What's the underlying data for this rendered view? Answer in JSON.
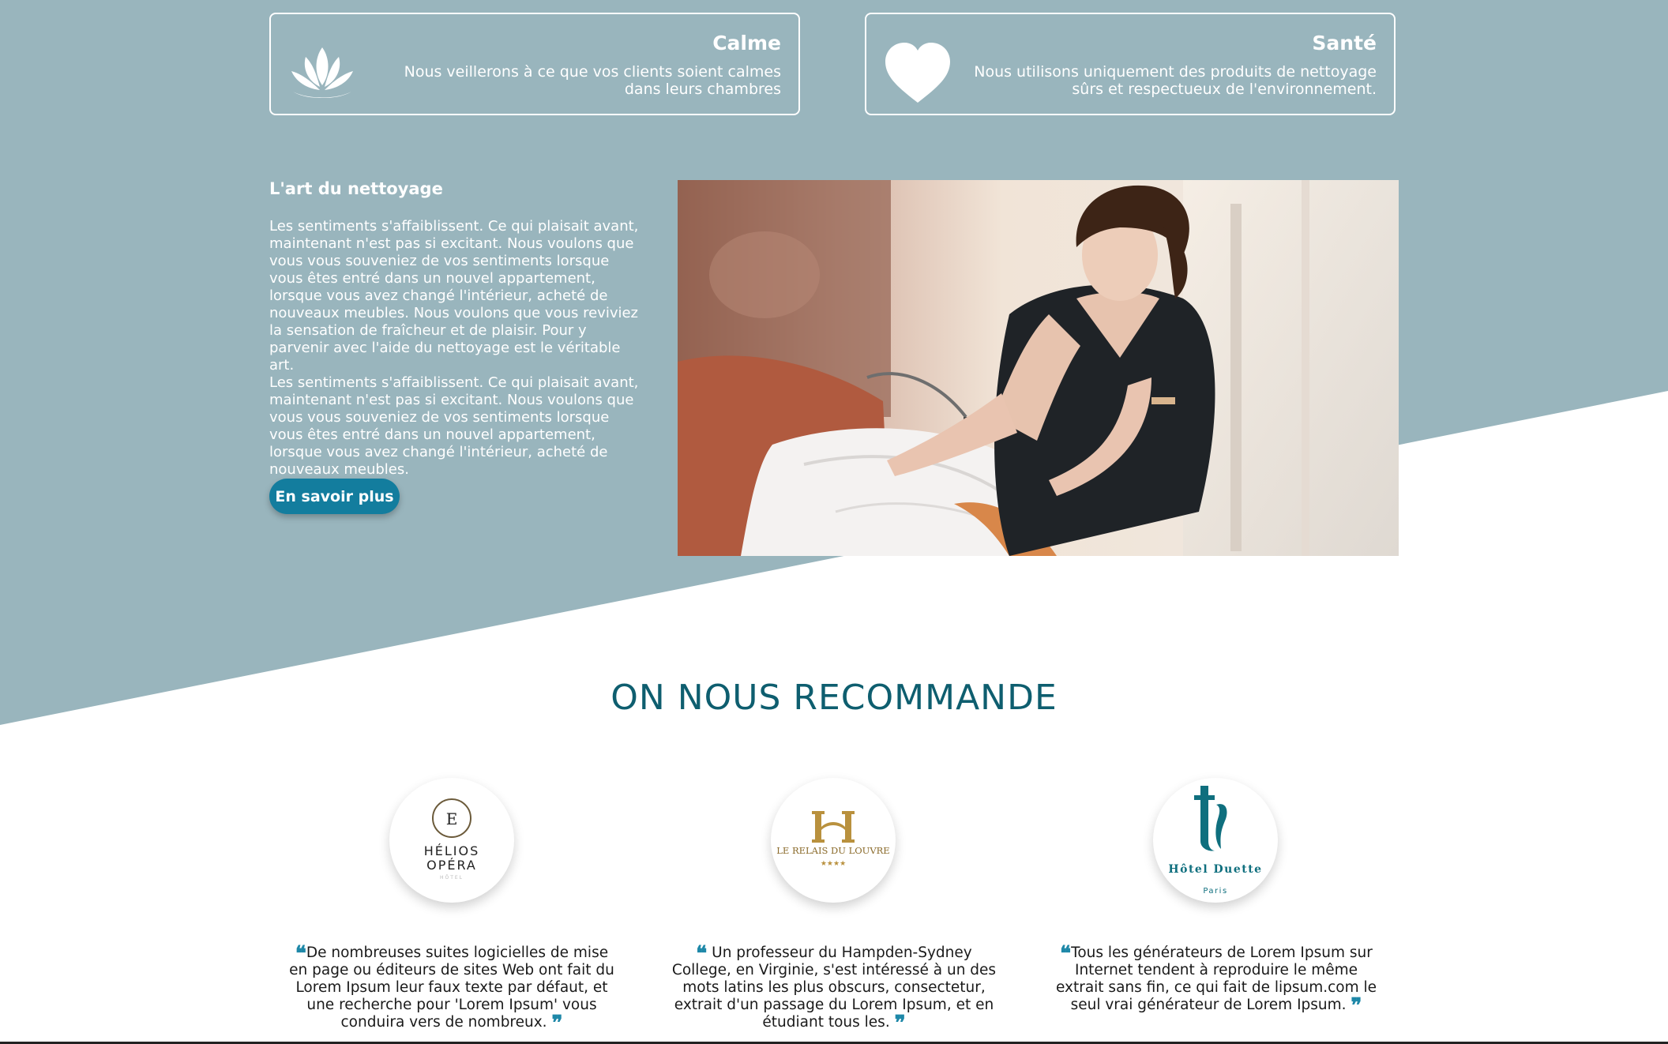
{
  "colors": {
    "background_teal": "#99b5bd",
    "accent_button": "#137d9e",
    "heading_dark_teal": "#0e5e6f",
    "quote_mark": "#1e88a8"
  },
  "features": [
    {
      "icon": "lotus-icon",
      "title": "Calme",
      "text": "Nous veillerons à ce que vos clients soient calmes dans leurs chambres"
    },
    {
      "icon": "heart-icon",
      "title": "Santé",
      "text": "Nous utilisons uniquement des produits de nettoyage sûrs et respectueux de l'environnement."
    }
  ],
  "art": {
    "title": "L'art du nettoyage",
    "paragraph1": "Les sentiments s'affaiblissent. Ce qui plaisait avant, maintenant n'est pas si excitant. Nous voulons que vous vous souveniez de vos sentiments lorsque vous êtes entré dans un nouvel appartement, lorsque vous avez changé l'intérieur, acheté de nouveaux meubles. Nous voulons que vous reviviez la sensation de fraîcheur et de plaisir. Pour y parvenir avec l'aide du nettoyage est le véritable art.",
    "paragraph2": "Les sentiments s'affaiblissent. Ce qui plaisait avant, maintenant n'est pas si excitant. Nous voulons que vous vous souveniez de vos sentiments lorsque vous êtes entré dans un nouvel appartement, lorsque vous avez changé l'intérieur, acheté de nouveaux meubles.",
    "button_label": "En savoir plus"
  },
  "recommend": {
    "title": "ON NOUS RECOMMANDE",
    "testimonials": [
      {
        "logo_line1": "HÉLIOS",
        "logo_line2": "OPÉRA",
        "logo_small": "HÔTEL",
        "logo_letter": "E",
        "quote": "De nombreuses suites logicielles de mise en page ou éditeurs de sites Web ont fait du Lorem Ipsum leur faux texte par défaut, et une recherche pour 'Lorem Ipsum' vous conduira vers de nombreux."
      },
      {
        "logo_line1": "LE RELAIS DU LOUVRE",
        "logo_stars": "★★★★",
        "quote": "Un professeur du Hampden-Sydney College, en Virginie, s'est intéressé à un des mots latins les plus obscurs, consectetur, extrait d'un passage du Lorem Ipsum, et en étudiant tous les."
      },
      {
        "logo_line1": "Hôtel Duette",
        "logo_small": "Paris",
        "quote": "Tous les générateurs de Lorem Ipsum sur Internet tendent à reproduire le même extrait sans fin, ce qui fait de lipsum.com le seul vrai générateur de Lorem Ipsum."
      }
    ],
    "open_quote": "❝",
    "close_quote": "❞"
  }
}
